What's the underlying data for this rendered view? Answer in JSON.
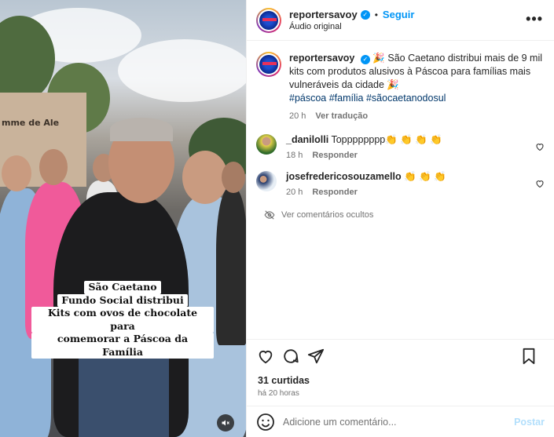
{
  "video": {
    "building_text": "mme de Ale",
    "caption_lines": [
      "São Caetano",
      "Fundo Social distribui",
      "Kits com ovos de chocolate para",
      "comemorar a Páscoa da Família"
    ]
  },
  "header": {
    "username": "reportersavoy",
    "follow_label": "Seguir",
    "audio_label": "Áudio original",
    "more_label": "•••"
  },
  "post": {
    "username": "reportersavoy",
    "text": "🎉 São Caetano distribui mais de 9 mil kits com produtos alusivos à Páscoa para famílias mais vulneráveis da cidade 🎉",
    "hashtags": "#páscoa #família #sãocaetanodosul",
    "time": "20 h",
    "translate_label": "Ver tradução"
  },
  "comments": [
    {
      "username": "_danilolli",
      "text": "Topppppppp👏 👏 👏 👏",
      "time": "18 h",
      "reply_label": "Responder"
    },
    {
      "username": "josefredericosouzamello",
      "text": "👏 👏 👏",
      "time": "20 h",
      "reply_label": "Responder"
    }
  ],
  "hidden_comments_label": "Ver comentários ocultos",
  "likes_label": "31 curtidas",
  "post_time": "há 20 horas",
  "add_comment": {
    "placeholder": "Adicione um comentário...",
    "post_label": "Postar"
  },
  "colors": {
    "accent": "#0095f6",
    "hashtag": "#00376b",
    "muted": "#737373",
    "post_disabled": "#b2dffc"
  },
  "icons": [
    "verified-icon",
    "more-icon",
    "eye-off-icon",
    "heart-icon",
    "comment-icon",
    "share-icon",
    "bookmark-icon",
    "emoji-icon",
    "mute-icon"
  ]
}
